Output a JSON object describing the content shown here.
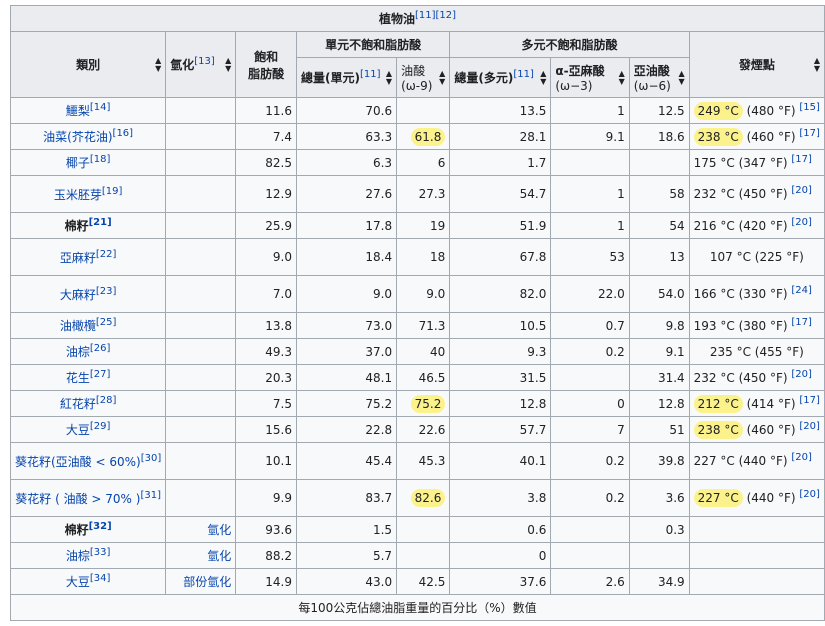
{
  "table": {
    "caption": "植物油",
    "caption_refs": "[11][12]",
    "headers": {
      "category": "類別",
      "hydrogenation": "氫化",
      "hydrogenation_ref": "[13]",
      "saturated_line1": "飽和",
      "saturated_line2": "脂肪酸",
      "mono_group": "單元不飽和脂肪酸",
      "poly_group": "多元不飽和脂肪酸",
      "smoke_point": "發煙點",
      "mono_total": "總量(單元)",
      "mono_total_ref": "[11]",
      "oleic_line1": "油酸",
      "oleic_line2": "(ω-9)",
      "poly_total": "總量(多元)",
      "poly_total_ref": "[11]",
      "ala_line1": "α-亞麻酸",
      "ala_line2": "(ω−3)",
      "linoleic_line1": "亞油酸",
      "linoleic_line2": "(ω−6)"
    },
    "rows": [
      {
        "name": "鱷梨",
        "ref": "[14]",
        "bold": false,
        "hyd": "",
        "sat": "11.6",
        "mono": "70.6",
        "oleic": "",
        "poly": "13.5",
        "ala": "1",
        "la": "12.5",
        "sp": "249 °C",
        "spf": "(480 °F)",
        "spref": "[15]",
        "hl_oleic": false,
        "hl_sp": true,
        "sp_align": "left"
      },
      {
        "name": "油菜(芥花油)",
        "ref": "[16]",
        "bold": false,
        "hyd": "",
        "sat": "7.4",
        "mono": "63.3",
        "oleic": "61.8",
        "poly": "28.1",
        "ala": "9.1",
        "la": "18.6",
        "sp": "238 °C",
        "spf": "(460 °F)",
        "spref": "[17]",
        "hl_oleic": true,
        "hl_sp": true,
        "sp_align": "left"
      },
      {
        "name": "椰子",
        "ref": "[18]",
        "bold": false,
        "hyd": "",
        "sat": "82.5",
        "mono": "6.3",
        "oleic": "6",
        "poly": "1.7",
        "ala": "",
        "la": "",
        "sp": "175 °C",
        "spf": "(347 °F)",
        "spref": "[17]",
        "hl_oleic": false,
        "hl_sp": false,
        "sp_align": "left"
      },
      {
        "name": "玉米胚芽",
        "ref": "[19]",
        "bold": false,
        "hyd": "",
        "sat": "12.9",
        "mono": "27.6",
        "oleic": "27.3",
        "poly": "54.7",
        "ala": "1",
        "la": "58",
        "sp": "232 °C",
        "spf": "(450 °F)",
        "spref": "[20]",
        "hl_oleic": false,
        "hl_sp": false,
        "sp_align": "left"
      },
      {
        "name": "棉籽",
        "ref": "[21]",
        "bold": true,
        "hyd": "",
        "sat": "25.9",
        "mono": "17.8",
        "oleic": "19",
        "poly": "51.9",
        "ala": "1",
        "la": "54",
        "sp": "216 °C",
        "spf": "(420 °F)",
        "spref": "[20]",
        "hl_oleic": false,
        "hl_sp": false,
        "sp_align": "left"
      },
      {
        "name": "亞麻籽",
        "ref": "[22]",
        "bold": false,
        "hyd": "",
        "sat": "9.0",
        "mono": "18.4",
        "oleic": "18",
        "poly": "67.8",
        "ala": "53",
        "la": "13",
        "sp": "107 °C",
        "spf": "(225 °F)",
        "spref": "",
        "hl_oleic": false,
        "hl_sp": false,
        "sp_align": "center"
      },
      {
        "name": "大麻籽",
        "ref": "[23]",
        "bold": false,
        "hyd": "",
        "sat": "7.0",
        "mono": "9.0",
        "oleic": "9.0",
        "poly": "82.0",
        "ala": "22.0",
        "la": "54.0",
        "sp": "166 °C",
        "spf": "(330 °F)",
        "spref": "[24]",
        "hl_oleic": false,
        "hl_sp": false,
        "sp_align": "left"
      },
      {
        "name": "油橄欖",
        "ref": "[25]",
        "bold": false,
        "hyd": "",
        "sat": "13.8",
        "mono": "73.0",
        "oleic": "71.3",
        "poly": "10.5",
        "ala": "0.7",
        "la": "9.8",
        "sp": "193 °C",
        "spf": "(380 °F)",
        "spref": "[17]",
        "hl_oleic": false,
        "hl_sp": false,
        "sp_align": "left"
      },
      {
        "name": "油棕",
        "ref": "[26]",
        "bold": false,
        "hyd": "",
        "sat": "49.3",
        "mono": "37.0",
        "oleic": "40",
        "poly": "9.3",
        "ala": "0.2",
        "la": "9.1",
        "sp": "235 °C",
        "spf": "(455 °F)",
        "spref": "",
        "hl_oleic": false,
        "hl_sp": false,
        "sp_align": "center"
      },
      {
        "name": "花生",
        "ref": "[27]",
        "bold": false,
        "hyd": "",
        "sat": "20.3",
        "mono": "48.1",
        "oleic": "46.5",
        "poly": "31.5",
        "ala": "",
        "la": "31.4",
        "sp": "232 °C",
        "spf": "(450 °F)",
        "spref": "[20]",
        "hl_oleic": false,
        "hl_sp": false,
        "sp_align": "left"
      },
      {
        "name": "紅花籽",
        "ref": "[28]",
        "bold": false,
        "hyd": "",
        "sat": "7.5",
        "mono": "75.2",
        "oleic": "75.2",
        "poly": "12.8",
        "ala": "0",
        "la": "12.8",
        "sp": "212 °C",
        "spf": "(414 °F)",
        "spref": "[17]",
        "hl_oleic": true,
        "hl_sp": true,
        "sp_align": "left"
      },
      {
        "name": "大豆",
        "ref": "[29]",
        "bold": false,
        "hyd": "",
        "sat": "15.6",
        "mono": "22.8",
        "oleic": "22.6",
        "poly": "57.7",
        "ala": "7",
        "la": "51",
        "sp": "238 °C",
        "spf": "(460 °F)",
        "spref": "[20]",
        "hl_oleic": false,
        "hl_sp": true,
        "sp_align": "left"
      },
      {
        "name": "葵花籽(亞油酸 < 60%)",
        "ref": "[30]",
        "bold": false,
        "hyd": "",
        "sat": "10.1",
        "mono": "45.4",
        "oleic": "45.3",
        "poly": "40.1",
        "ala": "0.2",
        "la": "39.8",
        "sp": "227 °C",
        "spf": "(440 °F)",
        "spref": "[20]",
        "hl_oleic": false,
        "hl_sp": false,
        "sp_align": "left"
      },
      {
        "name": "葵花籽 ( 油酸 > 70% )",
        "ref": "[31]",
        "bold": false,
        "hyd": "",
        "sat": "9.9",
        "mono": "83.7",
        "oleic": "82.6",
        "poly": "3.8",
        "ala": "0.2",
        "la": "3.6",
        "sp": "227 °C",
        "spf": "(440 °F)",
        "spref": "[20]",
        "hl_oleic": true,
        "hl_sp": true,
        "sp_align": "left"
      },
      {
        "name": "棉籽",
        "ref": "[32]",
        "bold": true,
        "hyd": "氫化",
        "sat": "93.6",
        "mono": "1.5",
        "oleic": "",
        "poly": "0.6",
        "ala": "",
        "la": "0.3",
        "sp": "",
        "spf": "",
        "spref": "",
        "hl_oleic": false,
        "hl_sp": false,
        "sp_align": "left"
      },
      {
        "name": "油棕",
        "ref": "[33]",
        "bold": false,
        "hyd": "氫化",
        "sat": "88.2",
        "mono": "5.7",
        "oleic": "",
        "poly": "0",
        "ala": "",
        "la": "",
        "sp": "",
        "spf": "",
        "spref": "",
        "hl_oleic": false,
        "hl_sp": false,
        "sp_align": "left"
      },
      {
        "name": "大豆",
        "ref": "[34]",
        "bold": false,
        "hyd": "部份氫化",
        "sat": "14.9",
        "mono": "43.0",
        "oleic": "42.5",
        "poly": "37.6",
        "ala": "2.6",
        "la": "34.9",
        "sp": "",
        "spf": "",
        "spref": "",
        "hl_oleic": false,
        "hl_sp": false,
        "sp_align": "left"
      }
    ],
    "footer": "每100公克佔總油脂重量的百分比（%）數值",
    "sort_glyph": "▲▼",
    "highlight_color": "#fbf28c"
  }
}
